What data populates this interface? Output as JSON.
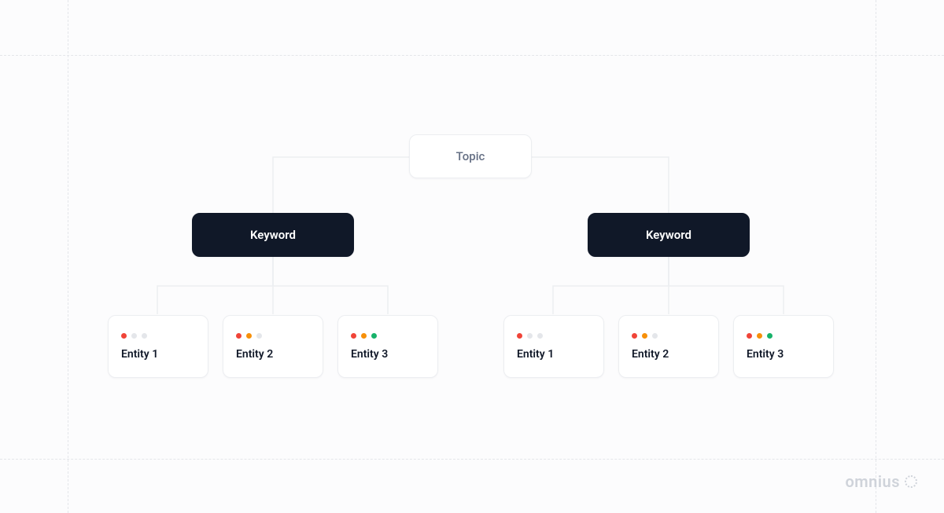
{
  "root": {
    "label": "Topic"
  },
  "branches": [
    {
      "keyword": "Keyword",
      "entities": [
        {
          "label": "Entity 1",
          "dots": [
            "red",
            "grey",
            "grey"
          ]
        },
        {
          "label": "Entity 2",
          "dots": [
            "red",
            "orange",
            "grey"
          ]
        },
        {
          "label": "Entity 3",
          "dots": [
            "red",
            "orange",
            "green"
          ]
        }
      ]
    },
    {
      "keyword": "Keyword",
      "entities": [
        {
          "label": "Entity 1",
          "dots": [
            "red",
            "grey",
            "grey"
          ]
        },
        {
          "label": "Entity 2",
          "dots": [
            "red",
            "orange",
            "grey"
          ]
        },
        {
          "label": "Entity 3",
          "dots": [
            "red",
            "orange",
            "green"
          ]
        }
      ]
    }
  ],
  "brand": "omnius",
  "colors": {
    "red": "#f04438",
    "orange": "#f79009",
    "green": "#17b26a",
    "grey": "#e4e6ea"
  }
}
